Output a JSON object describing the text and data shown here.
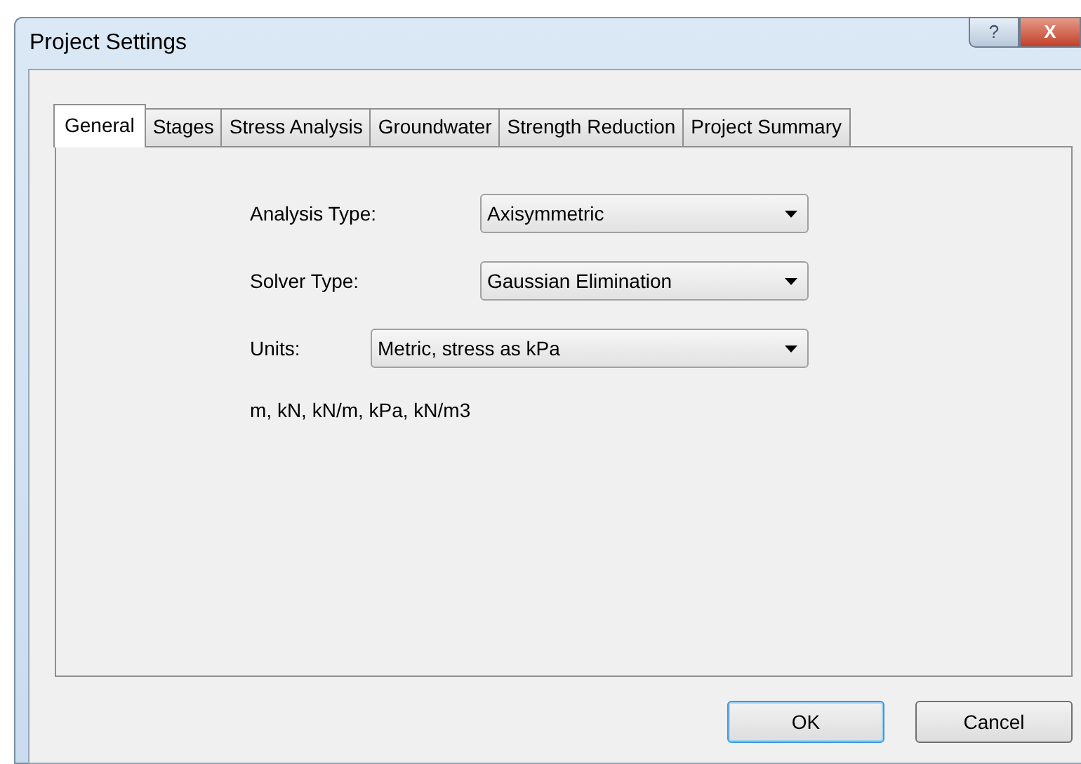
{
  "window": {
    "title": "Project Settings",
    "title_buttons": [
      {
        "kind": "help",
        "label": "?"
      },
      {
        "kind": "close",
        "label": "X"
      }
    ]
  },
  "tabs": [
    {
      "label": "General",
      "selected": true
    },
    {
      "label": "Stages",
      "selected": false
    },
    {
      "label": "Stress Analysis",
      "selected": false
    },
    {
      "label": "Groundwater",
      "selected": false
    },
    {
      "label": "Strength Reduction",
      "selected": false
    },
    {
      "label": "Project Summary",
      "selected": false
    }
  ],
  "fields": [
    {
      "label": "Analysis Type:",
      "value": "Axisymmetric",
      "kind": "short"
    },
    {
      "label": "Solver Type:",
      "value": "Gaussian Elimination",
      "kind": "short"
    },
    {
      "label": "Units:",
      "value": "Metric, stress as kPa",
      "kind": "wide"
    }
  ],
  "units_note": "m, kN, kN/m, kPa, kN/m3",
  "buttons": [
    {
      "label": "OK",
      "default": true
    },
    {
      "label": "Cancel",
      "default": false
    }
  ]
}
